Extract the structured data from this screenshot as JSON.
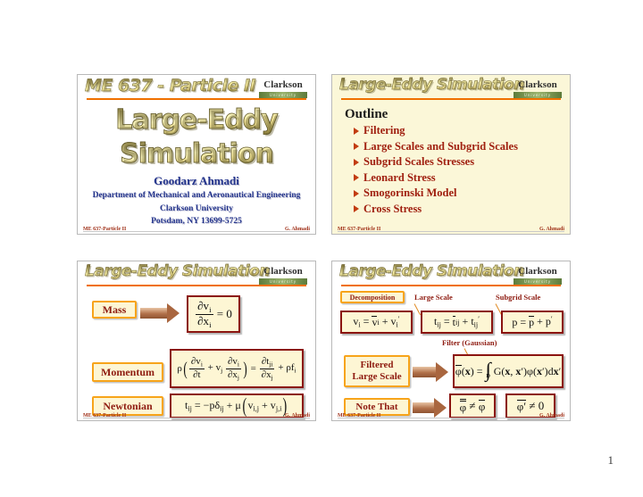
{
  "document": {
    "page_number": "1"
  },
  "branding": {
    "logo_name": "Clarkson",
    "logo_sub": "University"
  },
  "slides": [
    {
      "id": "title",
      "header_title": "ME 637 - Particle II",
      "main_title_line1": "Large-Eddy",
      "main_title_line2": "Simulation",
      "author": "Goodarz Ahmadi",
      "affiliation_line1": "Department of Mechanical and Aeronautical Engineering",
      "affiliation_line2": "Clarkson University",
      "affiliation_line3": "Potsdam, NY 13699-5725",
      "footer_left": "ME 637-Particle II",
      "footer_right": "G. Ahmadi"
    },
    {
      "id": "outline",
      "header_title": "Large-Eddy Simulation",
      "heading": "Outline",
      "items": [
        "Filtering",
        "Large Scales and Subgrid Scales",
        "Subgrid Scales Stresses",
        "Leonard Stress",
        "Smogorinski Model",
        "Cross Stress"
      ],
      "footer_left": "ME 637-Particle II",
      "footer_right": "G. Ahmadi"
    },
    {
      "id": "equations",
      "header_title": "Large-Eddy Simulation",
      "labels": {
        "mass": "Mass",
        "momentum": "Momentum",
        "newtonian": "Newtonian"
      },
      "equations": {
        "continuity": "∂v_i/∂x_i = 0",
        "momentum": "ρ(∂v_i/∂t + v_j ∂v_i/∂x_j) = ∂t_ji/∂x_j + ρf_i",
        "newtonian": "t_ij = −pδ_ij + μ(v_i,j + v_j,i)"
      },
      "footer_left": "ME 637-Particle II",
      "footer_right": "G. Ahmadi"
    },
    {
      "id": "decomposition",
      "header_title": "Large-Eddy Simulation",
      "labels": {
        "decomposition": "Decomposition",
        "large_scale": "Large Scale",
        "subgrid_scale": "Subgrid Scale",
        "filter": "Filter (Gaussian)",
        "filtered_large_scale_line1": "Filtered",
        "filtered_large_scale_line2": "Large Scale",
        "note_that": "Note That"
      },
      "equations": {
        "velocity_decomp": "v_i = v̄_i + v′_i",
        "stress_decomp": "t_ij = t̄_ij + t′_ij",
        "pressure_decomp": "p = p̄ + p′",
        "filter": "φ̄(x) = ∫_D G(x, x′)φ(x′)dx′",
        "note1": "φ̿ ≠ φ̄",
        "note2": "φ̄′ ≠ 0"
      },
      "footer_left": "ME 637-Particle II",
      "footer_right": "G. Ahmadi"
    }
  ]
}
